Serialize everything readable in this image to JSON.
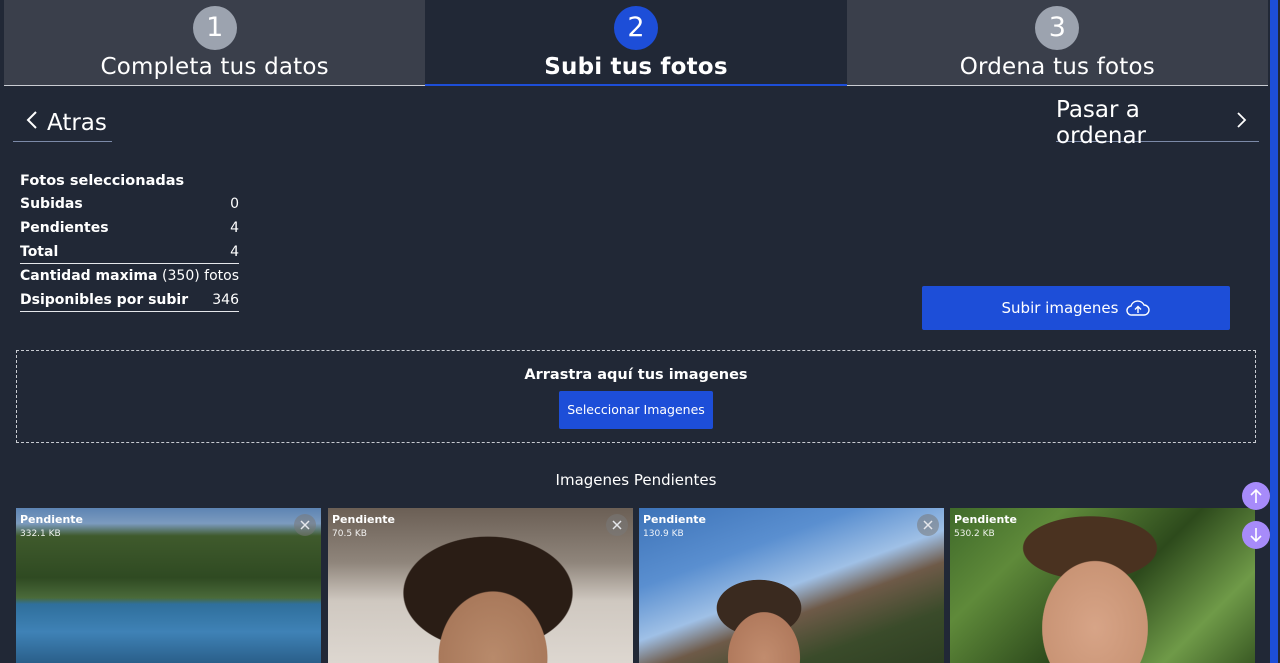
{
  "stepper": {
    "steps": [
      {
        "num": "1",
        "label": "Completa tus datos"
      },
      {
        "num": "2",
        "label": "Subi tus fotos"
      },
      {
        "num": "3",
        "label": "Ordena tus fotos"
      }
    ]
  },
  "nav": {
    "back": "Atras",
    "next": "Pasar a ordenar"
  },
  "summary": {
    "title": "Fotos seleccionadas",
    "rows": [
      {
        "k": "Subidas",
        "v": "0"
      },
      {
        "k": "Pendientes",
        "v": "4"
      },
      {
        "k": "Total",
        "v": "4"
      },
      {
        "k": "Cantidad maxima",
        "v": "(350) fotos"
      },
      {
        "k": "Dsiponibles por subir",
        "v": "346"
      }
    ]
  },
  "upload_button": "Subir imagenes",
  "dropzone": {
    "text": "Arrastra aquí tus imagenes",
    "button": "Seleccionar Imagenes"
  },
  "pending_heading": "Imagenes Pendientes",
  "thumbs": [
    {
      "status": "Pendiente",
      "size": "332.1 KB"
    },
    {
      "status": "Pendiente",
      "size": "70.5 KB"
    },
    {
      "status": "Pendiente",
      "size": "130.9 KB"
    },
    {
      "status": "Pendiente",
      "size": "530.2 KB"
    }
  ],
  "colors": {
    "bg": "#212836",
    "accent": "#1d4ed8",
    "fab": "#a78bfa"
  }
}
